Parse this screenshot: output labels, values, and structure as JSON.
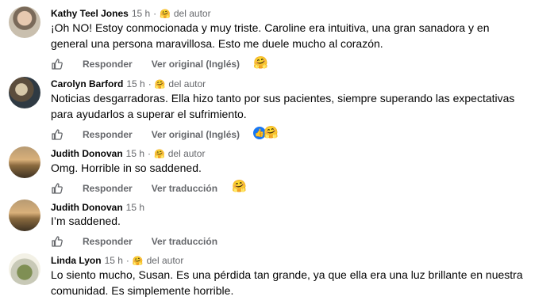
{
  "comments": [
    {
      "name": "Kathy Teel Jones",
      "time": "15 h",
      "badge_emoji": "🤗",
      "badge_text": "del autor",
      "text": "¡Oh NO! Estoy conmocionada y muy triste. Caroline era intuitiva, una gran sanadora y en general una persona maravillosa. Esto me duele mucho al corazón.",
      "reply": "Responder",
      "translate": "Ver original (Inglés)",
      "reaction": "🤗"
    },
    {
      "name": "Carolyn Barford",
      "time": "15 h",
      "badge_emoji": "🤗",
      "badge_text": "del autor",
      "text": "Noticias desgarradoras. Ella hizo tanto por sus pacientes, siempre superando las expectativas para ayudarlos a superar el sufrimiento.",
      "reply": "Responder",
      "translate": "Ver original (Inglés)",
      "reaction_like": "👍",
      "reaction": "🤗"
    },
    {
      "name": "Judith Donovan",
      "time": "15 h",
      "badge_emoji": "🤗",
      "badge_text": "del autor",
      "text": "Omg. Horrible in so saddened.",
      "reply": "Responder",
      "translate": "Ver traducción",
      "reaction": "🤗"
    },
    {
      "name": "Judith Donovan",
      "time": "15 h",
      "text": "I’m saddened.",
      "reply": "Responder",
      "translate": "Ver traducción"
    },
    {
      "name": "Linda Lyon",
      "time": "15 h",
      "badge_emoji": "🤗",
      "badge_text": "del autor",
      "text": "Lo siento mucho, Susan. Es una pérdida tan grande, ya que ella era una luz brillante en nuestra comunidad. Es simplemente horrible."
    }
  ],
  "separator": "·",
  "colors": {
    "meta": "#65676b",
    "text": "#050505",
    "like_blue": "#1877f2"
  },
  "icons": [
    "thumbs-up-icon",
    "care-emoji-icon",
    "like-reaction-icon"
  ]
}
